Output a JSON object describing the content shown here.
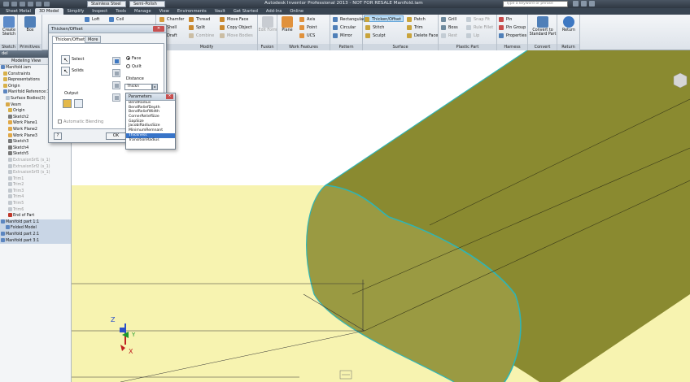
{
  "titlebar": {
    "material": "Stainless Steel",
    "appearance": "Semi-Polish",
    "app_title": "Autodesk Inventor Professional 2013 - NOT FOR RESALE  Manifold.iam",
    "search_placeholder": "Type a keyword or phrase"
  },
  "tabs": [
    "Sheet Metal",
    "3D Model",
    "Simplify",
    "Inspect",
    "Tools",
    "Manage",
    "View",
    "Environments",
    "Vault",
    "Get Started",
    "Add-Ins",
    "Online"
  ],
  "ribbon": {
    "sketch": {
      "create_label": "Create",
      "sketch_label": "Sketch",
      "panel": "Sketch"
    },
    "primitives": {
      "box_label": "Box",
      "panel": "Primitives"
    },
    "create": {
      "loft": "Loft",
      "coil": "Coil"
    },
    "modify": {
      "chamfer": "Chamfer",
      "thread": "Thread",
      "move_face": "Move Face",
      "shell": "Shell",
      "split": "Split",
      "copy_object": "Copy Object",
      "draft": "Draft",
      "combine": "Combine",
      "move_bodies": "Move Bodies",
      "panel": "Modify"
    },
    "fusion": {
      "edit_form": "Edit Form",
      "panel": "Fusion"
    },
    "work_features": {
      "plane": "Plane",
      "axis": "Axis",
      "point": "Point",
      "ucs": "UCS",
      "panel": "Work Features"
    },
    "pattern": {
      "rectangular": "Rectangular",
      "circular": "Circular",
      "mirror": "Mirror",
      "panel": "Pattern"
    },
    "surface": {
      "thicken_offset": "Thicken/Offset",
      "patch": "Patch",
      "stitch": "Stitch",
      "trim": "Trim",
      "sculpt": "Sculpt",
      "delete_face": "Delete Face",
      "panel": "Surface"
    },
    "plastic_part": {
      "grill": "Grill",
      "snap_fit": "Snap Fit",
      "boss": "Boss",
      "rule_fillet": "Rule Fillet",
      "rest": "Rest",
      "lip": "Lip",
      "panel": "Plastic Part"
    },
    "harness": {
      "pin": "Pin",
      "pin_group": "Pin Group",
      "properties": "Properties",
      "panel": "Harness"
    },
    "convert": {
      "convert_label": "Convert to Standard Part",
      "panel": "Convert"
    },
    "return": {
      "return_label": "Return",
      "panel": "Return"
    }
  },
  "browser": {
    "header": "del",
    "view": "Modeling View",
    "items": [
      {
        "label": "Manifold.iam",
        "dim": false
      },
      {
        "label": "Constraints",
        "dim": false
      },
      {
        "label": "Representations",
        "dim": false
      },
      {
        "label": "Origin",
        "dim": false
      },
      {
        "label": "Manifold Reference:1",
        "dim": false
      },
      {
        "label": "Surface Bodies(3)",
        "dim": false
      },
      {
        "label": "Vesm",
        "dim": false
      },
      {
        "label": "Origin",
        "dim": false
      },
      {
        "label": "Sketch2",
        "dim": false
      },
      {
        "label": "Work Plane1",
        "dim": false
      },
      {
        "label": "Work Plane2",
        "dim": false
      },
      {
        "label": "Work Plane3",
        "dim": false
      },
      {
        "label": "Sketch3",
        "dim": false
      },
      {
        "label": "Sketch4",
        "dim": false
      },
      {
        "label": "Sketch5",
        "dim": false
      },
      {
        "label": "ExtrusionSrf1 (s_1)",
        "dim": true
      },
      {
        "label": "ExtrusionSrf2 (s_1)",
        "dim": true
      },
      {
        "label": "ExtrusionSrf3 (s_1)",
        "dim": true
      },
      {
        "label": "Trim1",
        "dim": true
      },
      {
        "label": "Trim2",
        "dim": true
      },
      {
        "label": "Trim3",
        "dim": true
      },
      {
        "label": "Trim4",
        "dim": true
      },
      {
        "label": "Trim5",
        "dim": true
      },
      {
        "label": "Trim6",
        "dim": true
      },
      {
        "label": "End of Part",
        "dim": false
      },
      {
        "label": "Manifold part 1:1",
        "dim": false
      },
      {
        "label": "Folded Model",
        "dim": false
      },
      {
        "label": "Manifold part 2:1",
        "dim": false
      },
      {
        "label": "Manifold part 3:1",
        "dim": false
      }
    ]
  },
  "dialog": {
    "title": "Thicken/Offset",
    "tab_main": "Thicken/Offset",
    "tab_more": "More",
    "select": "Select",
    "solids": "Solids",
    "face": "Face",
    "quilt": "Quilt",
    "distance_label": "Distance",
    "distance_value": "Thickn",
    "output": "Output",
    "automatic_blending": "Automatic Blending",
    "ok": "OK",
    "help": "?"
  },
  "parameters": {
    "title": "Parameters",
    "items": [
      "BendRadius",
      "BendReliefDepth",
      "BendReliefWidth",
      "CornerReliefSize",
      "GapSize",
      "JacobiRadiusSize",
      "MinimumRemnant",
      "Thickness",
      "TransitionRadius"
    ],
    "selected_index": 7
  },
  "triad": {
    "x": "X",
    "y": "Y",
    "z": "Z"
  },
  "colors": {
    "body_olive": "#8a8a30",
    "body_edge": "#2fb5b5",
    "floor_yellow": "#f7f3b0",
    "selection_blue": "#3874c8"
  }
}
